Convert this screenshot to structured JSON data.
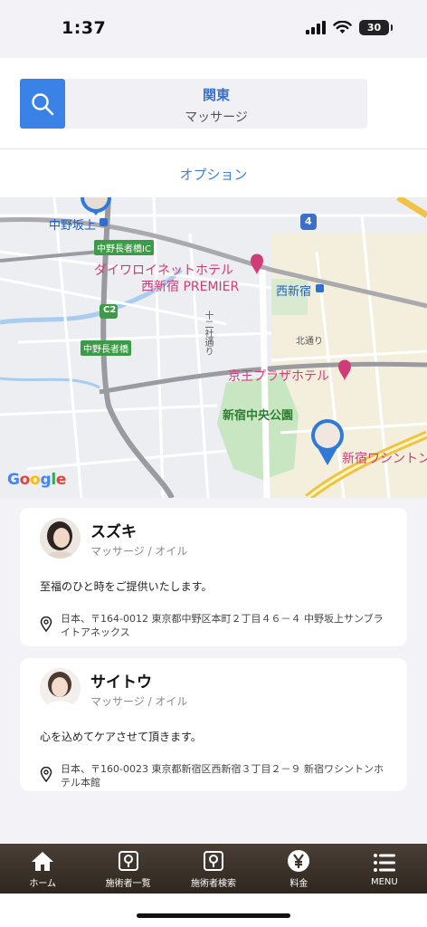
{
  "status_bar": {
    "time": "1:37",
    "battery": "30"
  },
  "search": {
    "region": "関東",
    "category": "マッサージ"
  },
  "option": {
    "label": "オプション"
  },
  "map": {
    "labels": {
      "nakano_sakaue": "中野坂上",
      "nakano_nagajabashi_ic": "中野長者橋IC",
      "route_c2": "C2",
      "nakano_nagajabashi": "中野長者橋",
      "route_4": "4",
      "hotel_daiwa_1": "ダイワロイネットホテル",
      "hotel_daiwa_2": "西新宿 PREMIER",
      "nishi_shinjuku": "西新宿",
      "jusso_dori": "十二社通り",
      "kita_dori": "北通り",
      "keio_plaza": "京王プラザホテル",
      "central_park": "新宿中央公園",
      "washington": "新宿ワシントン"
    },
    "google": "Google"
  },
  "therapists": [
    {
      "name": "スズキ",
      "service": "マッサージ / オイル",
      "description": "至福のひと時をご提供いたします。",
      "address": "日本、〒164-0012 東京都中野区本町２丁目４６－４ 中野坂上サンブライトアネックス"
    },
    {
      "name": "サイトウ",
      "service": "マッサージ / オイル",
      "description": "心を込めてケアさせて頂きます。",
      "address": "日本、〒160-0023 東京都新宿区西新宿３丁目２－９ 新宿ワシントンホテル本館"
    }
  ],
  "tabbar": {
    "items": [
      {
        "label": "ホーム",
        "icon": "home-icon"
      },
      {
        "label": "施術者一覧",
        "icon": "therapist-list-icon"
      },
      {
        "label": "施術者検索",
        "icon": "therapist-search-icon"
      },
      {
        "label": "料金",
        "icon": "yen-icon"
      },
      {
        "label": "MENU",
        "icon": "menu-icon"
      }
    ]
  },
  "colors": {
    "accent": "#3b82e6",
    "tabbar": "#3a3129",
    "hotel_pin": "#d03c78"
  }
}
